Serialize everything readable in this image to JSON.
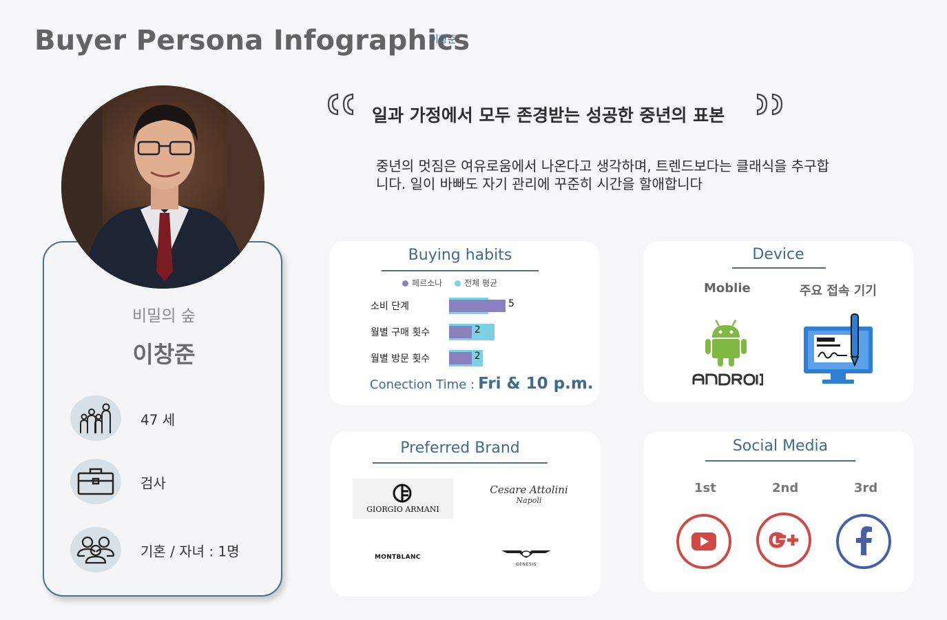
{
  "header": {
    "title": "Buyer Persona Infographics",
    "author": "이창준"
  },
  "profile": {
    "brand": "비밀의 숲",
    "name": "이창준",
    "age": "47 세",
    "job": "검사",
    "family": "기혼 / 자녀 : 1명"
  },
  "quote": {
    "main": "일과 가정에서 모두 존경받는 성공한 중년의 표본",
    "sub": "중년의 멋짐은 여유로움에서 나온다고 생각하며, 트렌드보다는 클래식을 추구합니다. 일이 바빠도 자기 관리에 꾸준히 시간을 할애합니다"
  },
  "buying": {
    "title": "Buying habits",
    "legend_persona": "페르소나",
    "legend_avg": "전체 평균",
    "connection_label": "Conection Time :",
    "connection_value": "Fri & 10 p.m."
  },
  "chart_data": {
    "type": "bar",
    "orientation": "horizontal",
    "categories": [
      "소비 단계",
      "월별 구매 횟수",
      "월별 방문 횟수"
    ],
    "series": [
      {
        "name": "페르소나",
        "values": [
          5,
          2,
          2
        ],
        "color": "#8a7fbf"
      },
      {
        "name": "전체 평균",
        "values": [
          3.5,
          4,
          3
        ],
        "color": "#7ad3e3"
      }
    ],
    "data_labels": [
      "5",
      "2",
      "2"
    ],
    "xlim": [
      0,
      5
    ]
  },
  "device": {
    "title": "Device",
    "mobile_label": "Moblie",
    "main_label": "주요 접속 기기",
    "android_word": "android",
    "android_icon": "android-icon",
    "computer_icon": "desktop-computer-icon"
  },
  "brand": {
    "title": "Preferred Brand",
    "armani": "GIORGIO ARMANI",
    "attolini_1": "Cesare Attolini",
    "attolini_2": "Napoli",
    "montblanc": "MONTBLANC",
    "genesis": "GENESIS"
  },
  "social": {
    "title": "Social Media",
    "rank1": "1st",
    "rank2": "2nd",
    "rank3": "3rd",
    "icon1": "youtube-icon",
    "icon2": "google-plus-icon",
    "icon3": "facebook-icon",
    "color_youtube": "#cf4a44",
    "color_google": "#cf4a44",
    "color_facebook": "#4560a7"
  },
  "colors": {
    "accent": "#3f6c8c",
    "persona_bar": "#8a7fbf",
    "avg_bar": "#7ad3e3",
    "android_green": "#7fb842",
    "computer_blue": "#2f7fd6"
  }
}
